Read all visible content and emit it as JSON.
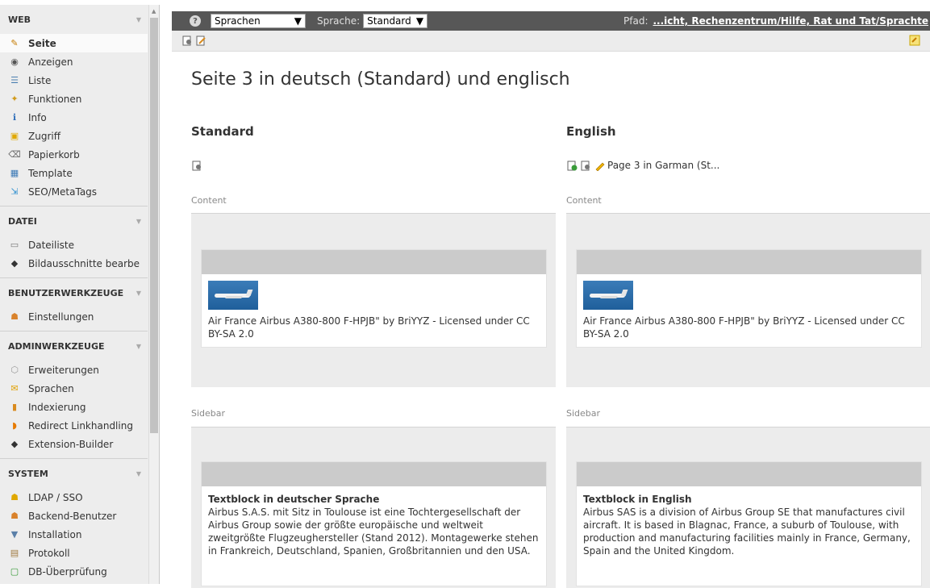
{
  "sidebar": {
    "groups": [
      {
        "title": "WEB",
        "items": [
          {
            "label": "Seite",
            "icon": "page-edit-icon",
            "active": true
          },
          {
            "label": "Anzeigen",
            "icon": "eye-icon"
          },
          {
            "label": "Liste",
            "icon": "list-icon"
          },
          {
            "label": "Funktionen",
            "icon": "wand-icon"
          },
          {
            "label": "Info",
            "icon": "info-icon"
          },
          {
            "label": "Zugriff",
            "icon": "lock-icon"
          },
          {
            "label": "Papierkorb",
            "icon": "trash-icon"
          },
          {
            "label": "Template",
            "icon": "template-icon"
          },
          {
            "label": "SEO/MetaTags",
            "icon": "seo-icon"
          }
        ]
      },
      {
        "title": "DATEI",
        "items": [
          {
            "label": "Dateiliste",
            "icon": "folder-icon"
          },
          {
            "label": "Bildausschnitte bearbe",
            "icon": "typo3-icon"
          }
        ]
      },
      {
        "title": "BENUTZERWERKZEUGE",
        "items": [
          {
            "label": "Einstellungen",
            "icon": "user-settings-icon"
          }
        ]
      },
      {
        "title": "ADMINWERKZEUGE",
        "items": [
          {
            "label": "Erweiterungen",
            "icon": "extensions-icon"
          },
          {
            "label": "Sprachen",
            "icon": "languages-icon"
          },
          {
            "label": "Indexierung",
            "icon": "bar-chart-icon"
          },
          {
            "label": "Redirect Linkhandling",
            "icon": "redirect-icon"
          },
          {
            "label": "Extension-Builder",
            "icon": "typo3-icon"
          }
        ]
      },
      {
        "title": "SYSTEM",
        "items": [
          {
            "label": "LDAP / SSO",
            "icon": "ldap-icon"
          },
          {
            "label": "Backend-Benutzer",
            "icon": "backend-user-icon"
          },
          {
            "label": "Installation",
            "icon": "install-icon"
          },
          {
            "label": "Protokoll",
            "icon": "log-icon"
          },
          {
            "label": "DB-Überprüfung",
            "icon": "db-check-icon"
          }
        ]
      }
    ]
  },
  "topbar": {
    "view_select": "Sprachen",
    "language_label": "Sprache:",
    "language_select": "Standard",
    "path_label": "Pfad:",
    "path_value": "...icht, Rechenzentrum/Hilfe, Rat und Tat/Sprachte"
  },
  "page_title": "Seite 3 in deutsch (Standard) und englisch",
  "columns": {
    "standard": {
      "heading": "Standard",
      "content_label": "Content",
      "content_text": "Air France Airbus A380-800 F-HPJB\" by BriYYZ - Licensed under CC BY-SA 2.0",
      "sidebar_label": "Sidebar",
      "sidebar_title": "Textblock in deutscher Sprache",
      "sidebar_text": "Airbus S.A.S. mit Sitz in Toulouse ist eine Tochtergesellschaft der Airbus Group sowie der größte europäische und weltweit zweitgrößte Flugzeughersteller (Stand 2012). Montagewerke stehen in Frankreich, Deutschland, Spanien, Großbritannien und den USA."
    },
    "english": {
      "heading": "English",
      "page_link": "Page 3 in Garman (St...",
      "content_label": "Content",
      "content_text": "Air France Airbus A380-800 F-HPJB\" by BriYYZ - Licensed under CC BY-SA 2.0",
      "sidebar_label": "Sidebar",
      "sidebar_title": "Textblock in English",
      "sidebar_text": "Airbus SAS is a division of Airbus Group SE that manufactures civil aircraft. It is based in Blagnac, France, a suburb of Toulouse, with production and manufacturing facilities mainly in France, Germany, Spain and the United Kingdom."
    }
  }
}
